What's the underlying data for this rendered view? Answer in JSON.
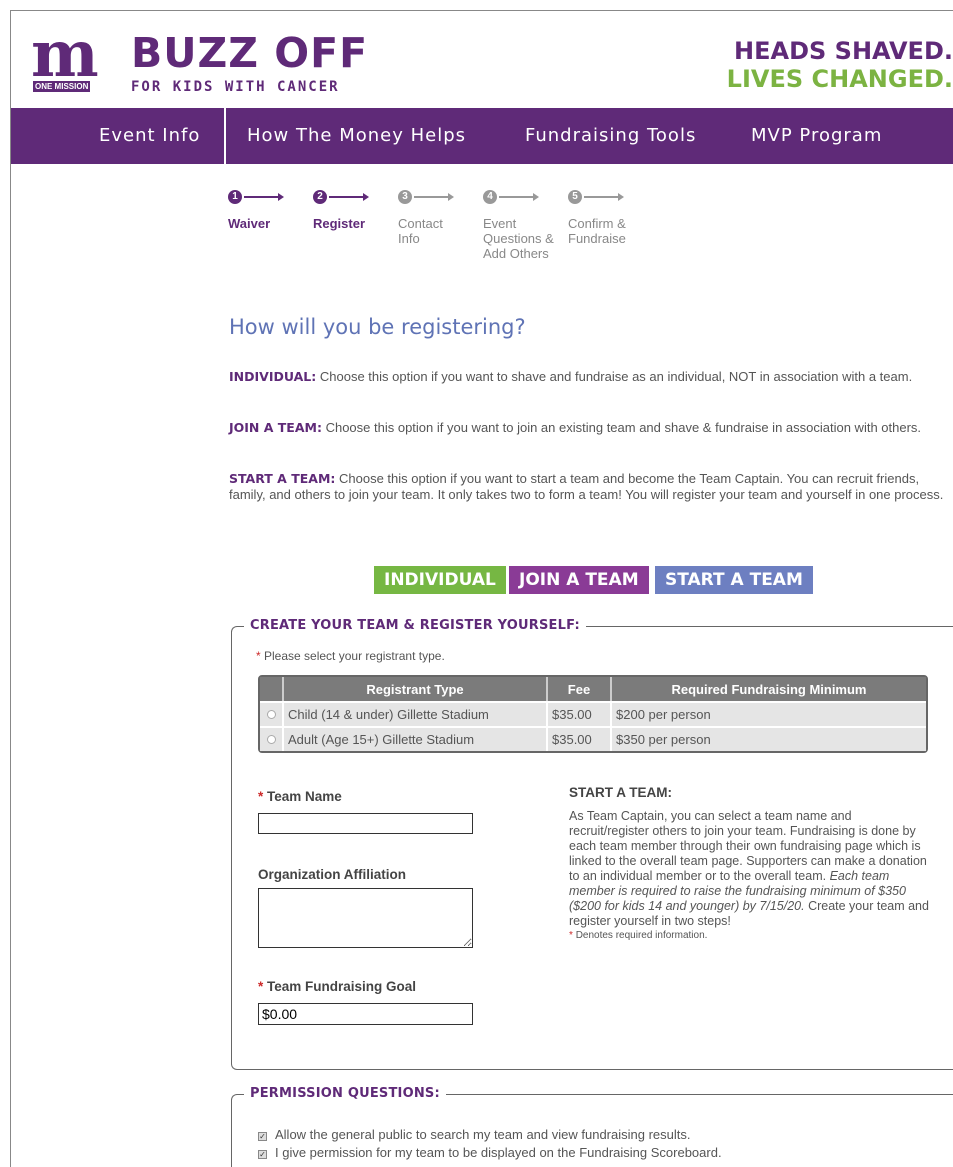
{
  "header": {
    "logo_letter": "m",
    "logo_sub": "ONE MISSION",
    "brand_title": "BUZZ OFF",
    "brand_subtitle": "FOR KIDS WITH CANCER",
    "tagline_1": "HEADS SHAVED.",
    "tagline_2": "LIVES CHANGED.",
    "colors": {
      "primary": "#5f2a78",
      "green": "#7cb342"
    }
  },
  "nav": {
    "items": [
      "Event Info",
      "How The Money Helps",
      "Fundraising Tools",
      "MVP Program"
    ]
  },
  "steps": [
    {
      "num": "1",
      "label": "Waiver",
      "state": "done"
    },
    {
      "num": "2",
      "label": "Register",
      "state": "done"
    },
    {
      "num": "3",
      "label": "Contact Info",
      "state": "todo"
    },
    {
      "num": "4",
      "label": "Event Questions & Add Others",
      "state": "todo"
    },
    {
      "num": "5",
      "label": "Confirm & Fundraise",
      "state": "todo"
    }
  ],
  "main": {
    "heading": "How will you be registering?",
    "individual_title": "INDIVIDUAL:",
    "individual_text": "Choose this option if you want to shave and fundraise as an individual, NOT in association with a team.",
    "join_title": "JOIN A TEAM:",
    "join_text": "Choose this option if you want to join an existing team and shave & fundraise in association with others.",
    "start_title": "START A TEAM:",
    "start_text": "Choose this option if you want to start a team and become the Team Captain. You can recruit friends, family, and others to join your team. It only takes two to form a team! You will register your team and yourself in one process.",
    "buttons": {
      "individual": "INDIVIDUAL",
      "join": "JOIN A TEAM",
      "start": "START A TEAM"
    }
  },
  "create": {
    "legend": "CREATE YOUR TEAM & REGISTER YOURSELF:",
    "required_mark": "*",
    "select_note": "Please select your registrant type.",
    "table": {
      "headers": [
        "Registrant Type",
        "Fee",
        "Required Fundraising Minimum"
      ],
      "rows": [
        [
          "Child (14 & under) Gillette Stadium",
          "$35.00",
          "$200 per person"
        ],
        [
          "Adult (Age 15+) Gillette Stadium",
          "$35.00",
          "$350 per person"
        ]
      ]
    },
    "team_name_label": "Team Name",
    "team_name_value": "",
    "org_label": "Organization Affiliation",
    "org_value": "",
    "goal_label": "Team Fundraising Goal",
    "goal_value": "$0.00",
    "desc_title": "START A TEAM:",
    "desc_text_1": "As Team Captain, you can select a team name and recruit/register others to join your team. Fundraising is done by each team member through their own fundraising page which is linked to the overall team page. Supporters can make a donation to an individual member or to the overall team.",
    "desc_italic": "Each team member is required to raise the fundraising minimum of $350 ($200 for kids 14 and younger) by 7/15/20.",
    "desc_text_2": "Create your team and register yourself in two steps!",
    "desc_required": "Denotes required information."
  },
  "permission": {
    "legend": "PERMISSION QUESTIONS:",
    "items": [
      "Allow the general public to search my team and view fundraising results.",
      "I give permission for my team to be displayed on the Fundraising Scoreboard."
    ]
  }
}
